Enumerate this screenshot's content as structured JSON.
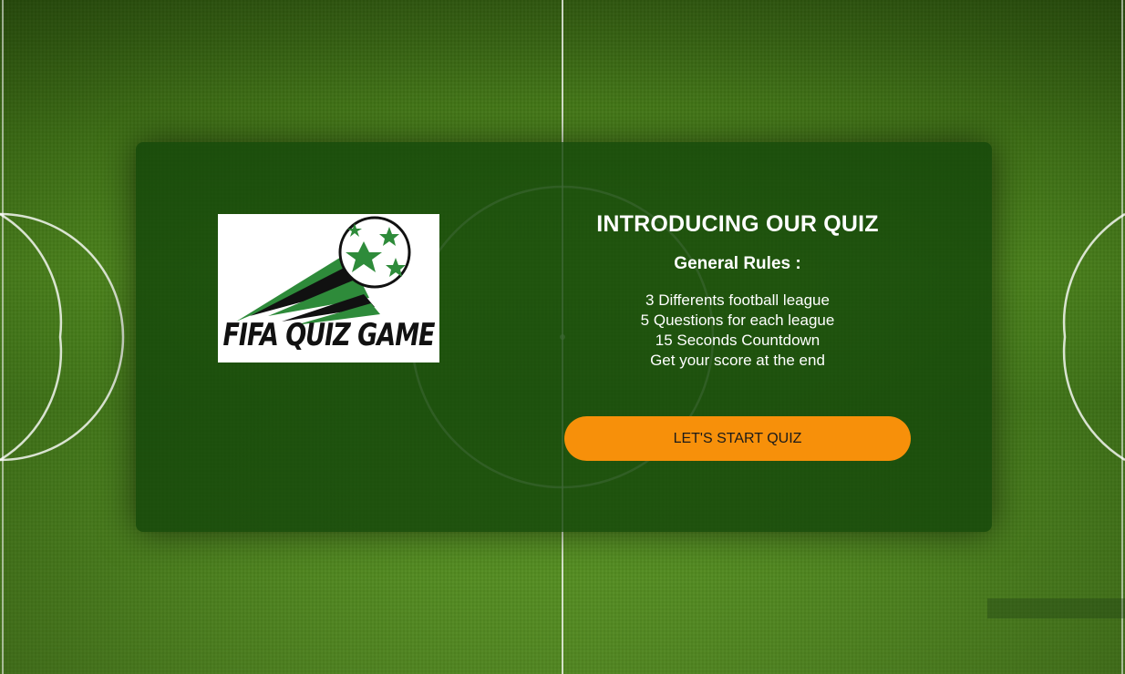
{
  "logo": {
    "text": "FIFA QUIZ GAME",
    "icon": "soccer-ball-icon"
  },
  "intro": {
    "title": "INTRODUCING OUR QUIZ",
    "rules_heading": "General Rules :",
    "rules": [
      "3 Differents football league",
      "5 Questions for each league",
      "15 Seconds Countdown",
      "Get your score at the end"
    ]
  },
  "start_button": {
    "label": "LET'S START QUIZ"
  },
  "colors": {
    "accent": "#f7900a",
    "card": "#14460a",
    "logo_green": "#2e8b3a"
  }
}
